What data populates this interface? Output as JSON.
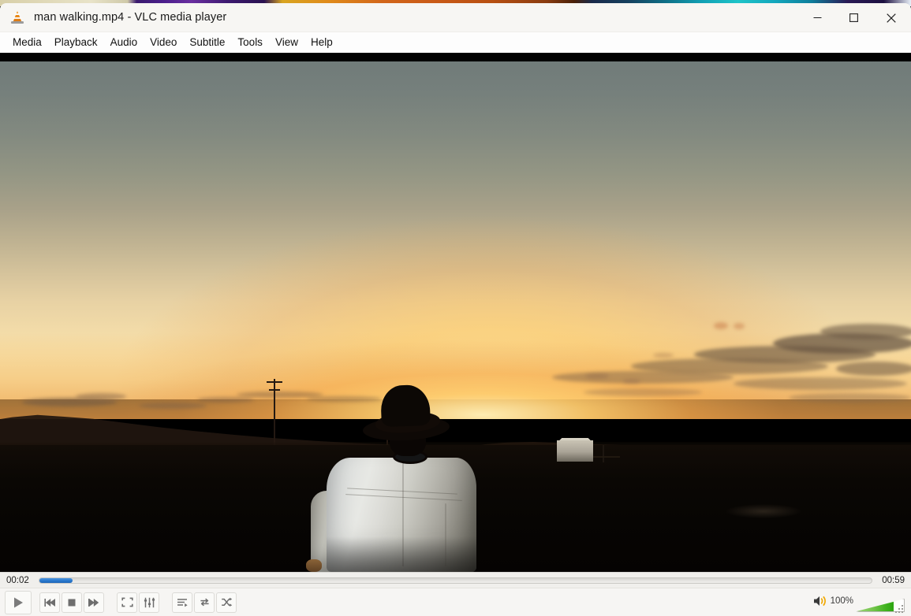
{
  "window": {
    "title": "man walking.mp4 - VLC media player",
    "app_icon": "vlc-cone-icon",
    "controls": {
      "minimize": "minimize-icon",
      "maximize": "maximize-icon",
      "close": "close-icon"
    }
  },
  "menubar": {
    "items": [
      {
        "label": "Media"
      },
      {
        "label": "Playback"
      },
      {
        "label": "Audio"
      },
      {
        "label": "Video"
      },
      {
        "label": "Subtitle"
      },
      {
        "label": "Tools"
      },
      {
        "label": "View"
      },
      {
        "label": "Help"
      }
    ]
  },
  "playback": {
    "elapsed": "00:02",
    "total": "00:59",
    "progress_percent": 4,
    "state": "playing",
    "seek_accent_color": "#2878cc"
  },
  "controls": {
    "play": "play-icon",
    "previous": "previous-track-icon",
    "stop": "stop-icon",
    "next": "next-track-icon",
    "fullscreen": "fullscreen-icon",
    "extended_settings": "equalizer-icon",
    "playlist": "playlist-icon",
    "loop": "loop-icon",
    "shuffle": "shuffle-icon"
  },
  "volume": {
    "icon": "speaker-icon",
    "percent_label": "100%",
    "level": 100,
    "fill_color": "#3fb21e"
  },
  "video": {
    "scene_description": "Man in cowboy hat and white shirt walking toward a desert sunset",
    "letterboxed": true
  }
}
